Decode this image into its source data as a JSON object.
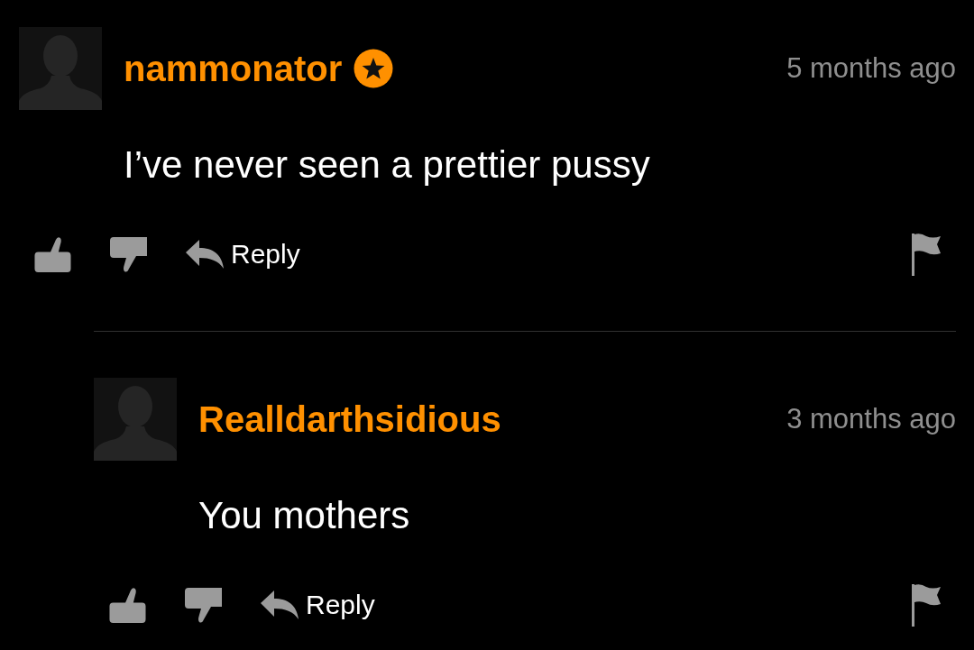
{
  "comments": [
    {
      "author": "nammonator",
      "badge": true,
      "time": "5 months ago",
      "text": "I’ve never seen a prettier pussy",
      "reply_label": "Reply",
      "replies": [
        {
          "author": "Realldarthsidious",
          "badge": false,
          "time": "3 months ago",
          "text": "You mothers",
          "reply_label": "Reply"
        }
      ]
    }
  ]
}
